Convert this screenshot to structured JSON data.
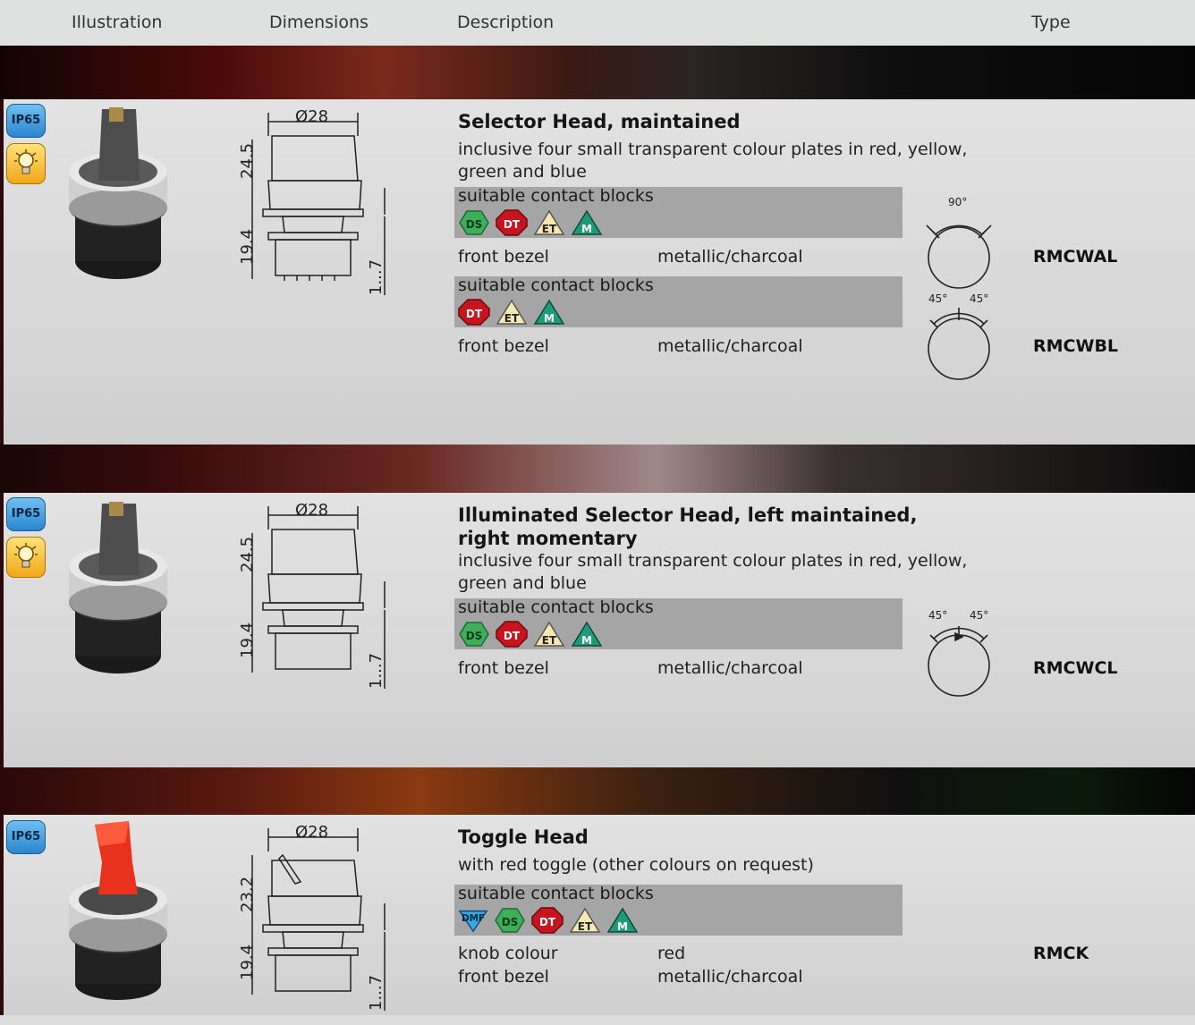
{
  "header": {
    "illustration": "Illustration",
    "dimensions": "Dimensions",
    "description": "Description",
    "type": "Type"
  },
  "colors": {
    "panel": "#dcdcdc",
    "contact_box": "#a5a5a5",
    "ip_badge": "#3a97da",
    "lamp_badge": "#f6c53c"
  },
  "badges": {
    "ip": "IP65"
  },
  "icon_labels": {
    "ds": "DS",
    "dt": "DT",
    "et": "ET",
    "m": "M",
    "dmf": "DMF"
  },
  "common": {
    "contact_label": "suitable contact blocks",
    "front_bezel": "front bezel",
    "bezel_value": "metallic/charcoal"
  },
  "products": [
    {
      "title": "Selector Head, maintained",
      "description": "inclusive four small transparent colour plates in red, yellow, green and blue",
      "dim_diameter": "Ø28",
      "dim_top": "24.5",
      "dim_bottom": "19.4",
      "dim_range": "1...7",
      "variants": [
        {
          "icons": [
            "ds",
            "dt",
            "et",
            "m"
          ],
          "angle_labels": [
            "90°"
          ],
          "type": "RMCWAL"
        },
        {
          "icons": [
            "dt",
            "et",
            "m"
          ],
          "angle_labels": [
            "45°",
            "45°"
          ],
          "type": "RMCWBL"
        }
      ]
    },
    {
      "title_line1": "Illuminated Selector Head, left maintained,",
      "title_line2": "right momentary",
      "description": "inclusive four small transparent colour plates in red, yellow, green and blue",
      "dim_diameter": "Ø28",
      "dim_top": "24.5",
      "dim_bottom": "19.4",
      "dim_range": "1...7",
      "variants": [
        {
          "icons": [
            "ds",
            "dt",
            "et",
            "m"
          ],
          "angle_labels": [
            "45°",
            "45°"
          ],
          "type": "RMCWCL"
        }
      ]
    },
    {
      "title": "Toggle Head",
      "description": "with red toggle (other colours on request)",
      "dim_diameter": "Ø28",
      "dim_top": "23.2",
      "dim_bottom": "19.4",
      "dim_range": "1...7",
      "knob_label": "knob colour",
      "knob_value": "red",
      "variants": [
        {
          "icons": [
            "dmf",
            "ds",
            "dt",
            "et",
            "m"
          ],
          "type": "RMCK"
        }
      ]
    }
  ]
}
